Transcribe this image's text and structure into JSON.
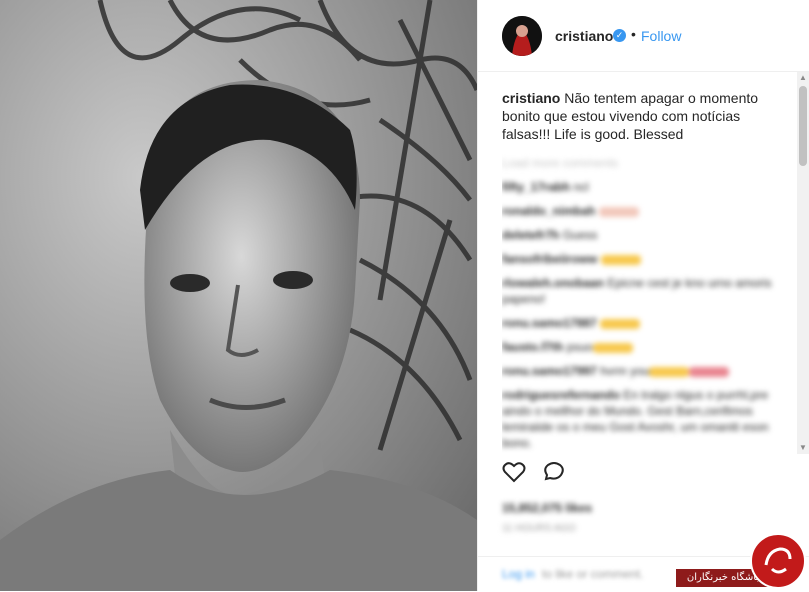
{
  "post": {
    "photo_alt": "",
    "username": "cristiano",
    "verified_symbol": "✓",
    "separator": "•",
    "follow_label": "Follow",
    "caption_username": "cristiano",
    "caption_text": "Não tentem apagar o momento bonito que estou vivendo com notícias falsas!!! Life is good. Blessed"
  },
  "comments": [
    {
      "user": "",
      "text": "Load more comments",
      "faint": true
    },
    {
      "user": "fifty_17rabh",
      "text": "ncl",
      "emoji": ""
    },
    {
      "user": "ronaldo_nimbah",
      "text": "",
      "emoji": "p"
    },
    {
      "user": "deletefr7h",
      "text": "Guess",
      "emoji": ""
    },
    {
      "user": "fansofribeiiroww",
      "text": "",
      "emoji": "y"
    },
    {
      "user": "rlowaleh.onobaan",
      "text": "Epicne cest je kno urno amoris papeno!",
      "emoji": ""
    },
    {
      "user": "ronu.samo17887",
      "text": "",
      "emoji": "y"
    },
    {
      "user": "fausto.f7th",
      "text": "psuo",
      "emoji": "y"
    },
    {
      "user": "ronu.samo17997",
      "text": "hvrm you",
      "emoji": "yr"
    },
    {
      "user": "rodriguesrefernando",
      "text": "En tralgo nlgus o purrhl,pre aindo o mellhor do Mundo. Gest Barn,cerifimos lemiraiide os o meu Gost Avoshr, um omaniti eson bono.",
      "emoji": ""
    }
  ],
  "actions": {
    "like_icon": "heart-outline-icon",
    "comment_icon": "comment-outline-icon"
  },
  "likes_text": "15,852,075 likes",
  "time_text": "11 HOURS AGO",
  "bottom": {
    "login_label": "Log in",
    "rest_text": "to like or comment."
  },
  "watermark": {
    "text": "باشگاه خبرنگاران"
  },
  "colors": {
    "accent": "#3897f0",
    "watermark_red": "#c21a1a"
  }
}
